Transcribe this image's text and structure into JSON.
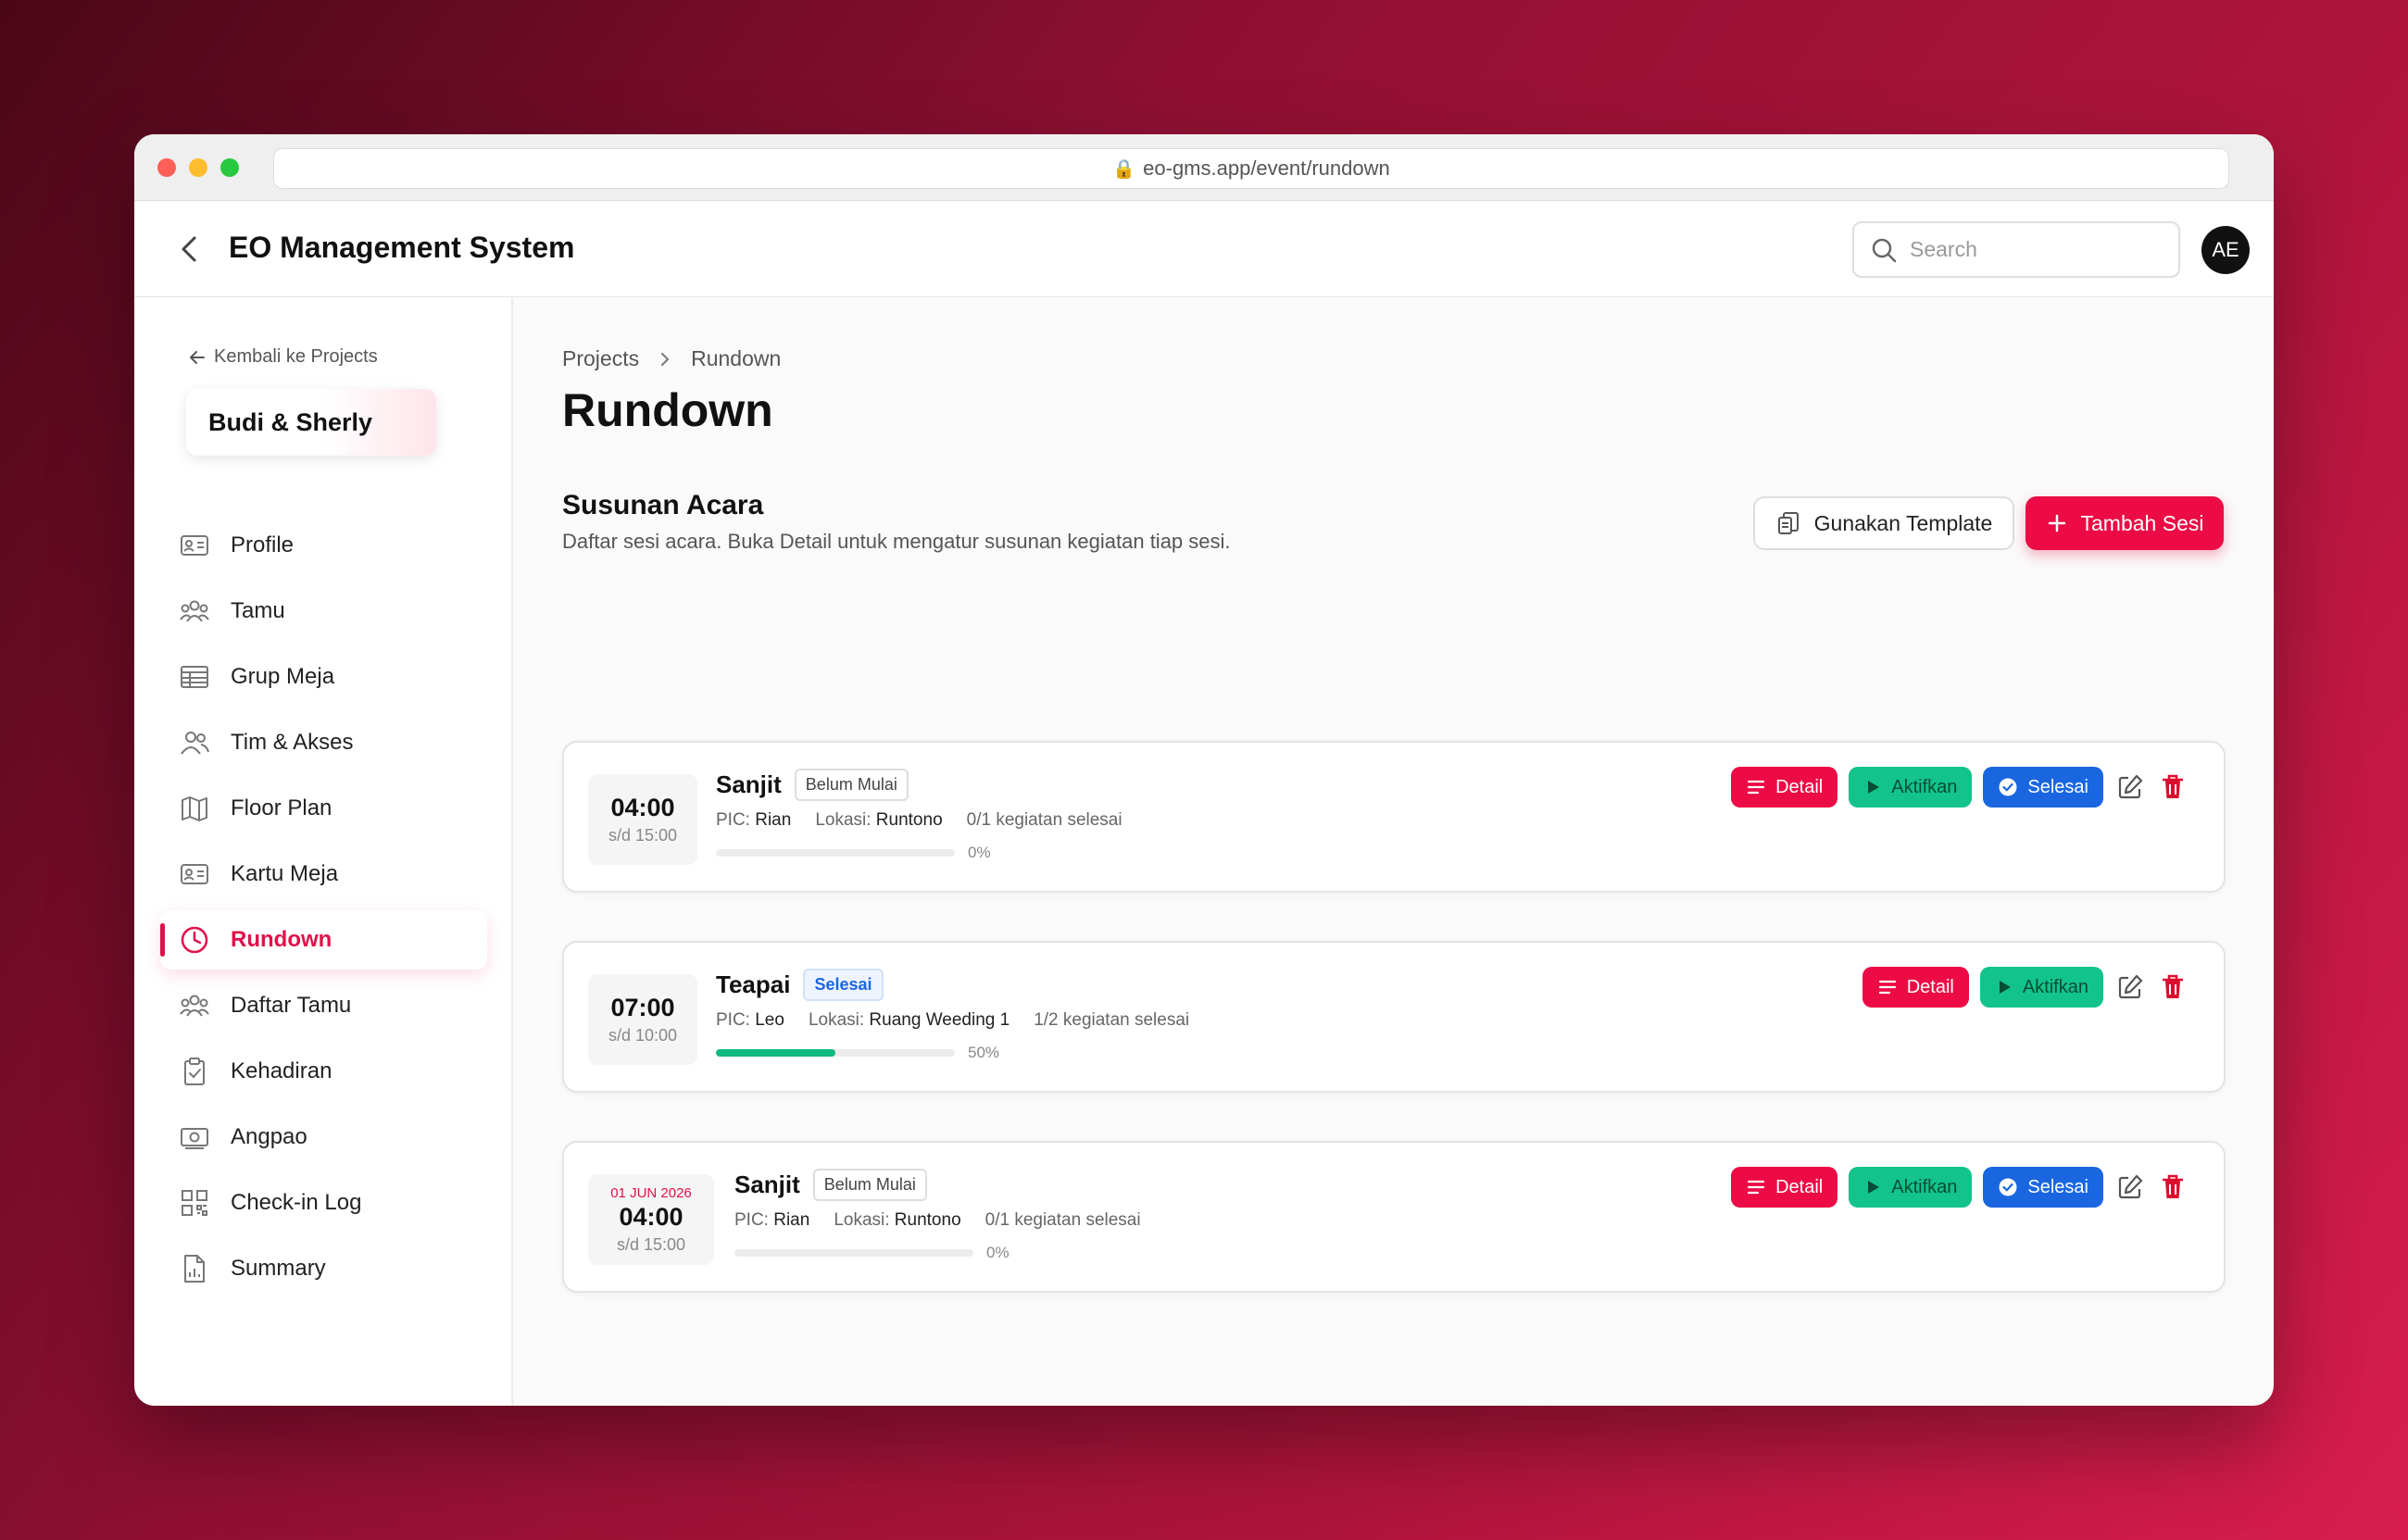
{
  "browser": {
    "url": "eo-gms.app/event/rundown"
  },
  "header": {
    "title": "EO Management System",
    "search_placeholder": "Search",
    "avatar_initials": "AE"
  },
  "sidebar": {
    "back_label": "Kembali ke Projects",
    "project_name": "Budi & Sherly",
    "items": [
      {
        "label": "Profile",
        "icon": "id-card-icon"
      },
      {
        "label": "Tamu",
        "icon": "users-icon"
      },
      {
        "label": "Grup Meja",
        "icon": "table-grid-icon"
      },
      {
        "label": "Tim & Akses",
        "icon": "team-icon"
      },
      {
        "label": "Floor Plan",
        "icon": "map-icon"
      },
      {
        "label": "Kartu Meja",
        "icon": "card-icon"
      },
      {
        "label": "Rundown",
        "icon": "clock-icon",
        "active": true
      },
      {
        "label": "Daftar Tamu",
        "icon": "guests-icon"
      },
      {
        "label": "Kehadiran",
        "icon": "clipboard-check-icon"
      },
      {
        "label": "Angpao",
        "icon": "money-icon"
      },
      {
        "label": "Check-in Log",
        "icon": "qr-icon"
      },
      {
        "label": "Summary",
        "icon": "report-icon"
      }
    ]
  },
  "main": {
    "breadcrumb": [
      "Projects",
      "Rundown"
    ],
    "title": "Rundown",
    "section_title": "Susunan Acara",
    "section_desc": "Daftar sesi acara. Buka Detail untuk mengatur susunan kegiatan tiap sesi.",
    "template_button": "Gunakan Template",
    "add_button": "Tambah Sesi",
    "labels": {
      "pic": "PIC:",
      "lokasi": "Lokasi:",
      "detail": "Detail",
      "aktifkan": "Aktifkan",
      "selesai": "Selesai"
    },
    "sessions": [
      {
        "date": "",
        "start": "04:00",
        "end": "s/d 15:00",
        "name": "Sanjit",
        "status": "Belum Mulai",
        "pic": "Rian",
        "lokasi": "Runtono",
        "count": "0/1 kegiatan selesai",
        "progress": 0,
        "progress_label": "0%"
      },
      {
        "date": "",
        "start": "07:00",
        "end": "s/d 10:00",
        "name": "Teapai",
        "status": "Selesai",
        "pic": "Leo",
        "lokasi": "Ruang Weeding 1",
        "count": "1/2 kegiatan selesai",
        "progress": 50,
        "progress_label": "50%"
      },
      {
        "date": "01 JUN 2026",
        "start": "04:00",
        "end": "s/d 15:00",
        "name": "Sanjit",
        "status": "Belum Mulai",
        "pic": "Rian",
        "lokasi": "Runtono",
        "count": "0/1 kegiatan selesai",
        "progress": 0,
        "progress_label": "0%"
      }
    ]
  },
  "colors": {
    "accent": "#ec0b45",
    "success": "#12c48b",
    "info": "#1a66e0"
  }
}
